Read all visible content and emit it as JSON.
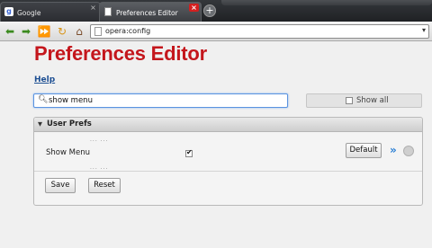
{
  "tabs": [
    {
      "label": "Google",
      "favicon": "google-favicon",
      "active": false
    },
    {
      "label": "Preferences Editor",
      "favicon": "document-icon",
      "active": true
    }
  ],
  "toolbar": {
    "address": "opera:config"
  },
  "page": {
    "title": "Preferences Editor",
    "help_link": "Help",
    "search_value": "show menu",
    "show_all_label": "Show all",
    "show_all_checked": false
  },
  "section": {
    "title": "User Prefs",
    "collapsed": false,
    "dots_top": "... ...",
    "dots_bottom": "... ...",
    "preference": {
      "name": "Show Menu",
      "checked": true,
      "check_glyph": "✔",
      "default_label": "Default"
    },
    "save_label": "Save",
    "reset_label": "Reset"
  },
  "colors": {
    "title": "#c4161c",
    "link": "#1d4f93",
    "tab_close": "#d31f1f",
    "search_border": "#5a93e0"
  }
}
